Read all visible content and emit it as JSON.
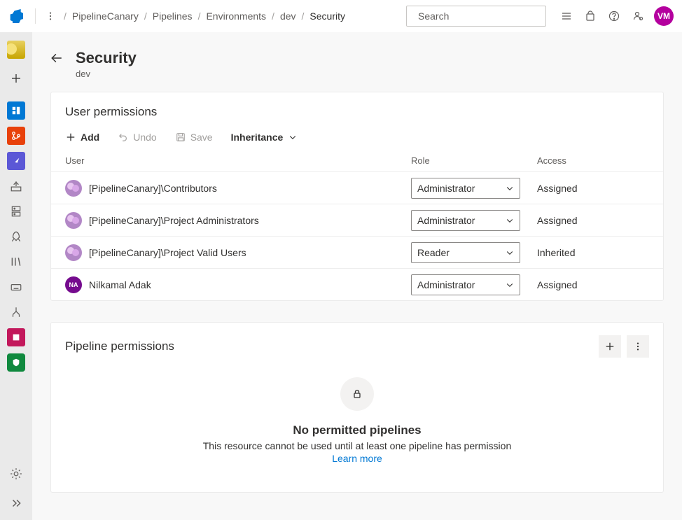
{
  "header": {
    "breadcrumbs": [
      "PipelineCanary",
      "Pipelines",
      "Environments",
      "dev",
      "Security"
    ],
    "search_placeholder": "Search",
    "avatar_initials": "VM"
  },
  "page": {
    "title": "Security",
    "subtitle": "dev"
  },
  "user_permissions": {
    "title": "User permissions",
    "toolbar": {
      "add_label": "Add",
      "undo_label": "Undo",
      "save_label": "Save",
      "inheritance_label": "Inheritance"
    },
    "columns": {
      "user": "User",
      "role": "Role",
      "access": "Access"
    },
    "rows": [
      {
        "name": "[PipelineCanary]\\Contributors",
        "avatar_type": "group",
        "role": "Administrator",
        "access": "Assigned"
      },
      {
        "name": "[PipelineCanary]\\Project Administrators",
        "avatar_type": "group",
        "role": "Administrator",
        "access": "Assigned"
      },
      {
        "name": "[PipelineCanary]\\Project Valid Users",
        "avatar_type": "group",
        "role": "Reader",
        "access": "Inherited"
      },
      {
        "name": "Nilkamal Adak",
        "avatar_type": "user",
        "avatar_initials": "NA",
        "role": "Administrator",
        "access": "Assigned"
      }
    ]
  },
  "pipeline_permissions": {
    "title": "Pipeline permissions",
    "empty_title": "No permitted pipelines",
    "empty_sub": "This resource cannot be used until at least one pipeline has permission",
    "empty_link": "Learn more"
  },
  "rail": {
    "items": [
      {
        "name": "plus-icon",
        "color": "#323130"
      },
      {
        "name": "boards-icon",
        "bg": "#0078d4"
      },
      {
        "name": "repos-icon",
        "bg": "#e8410b"
      },
      {
        "name": "pipelines-icon",
        "bg": "#5b57d6"
      },
      {
        "name": "deploy-icon",
        "color": "#605e5c"
      },
      {
        "name": "server-icon",
        "color": "#605e5c"
      },
      {
        "name": "rocket-icon",
        "color": "#605e5c"
      },
      {
        "name": "library-icon",
        "color": "#605e5c"
      },
      {
        "name": "keyboard-icon",
        "color": "#605e5c"
      },
      {
        "name": "filter-icon",
        "color": "#605e5c"
      },
      {
        "name": "artifacts-icon",
        "bg": "#c2185b"
      },
      {
        "name": "compliance-icon",
        "bg": "#10893e"
      }
    ]
  }
}
